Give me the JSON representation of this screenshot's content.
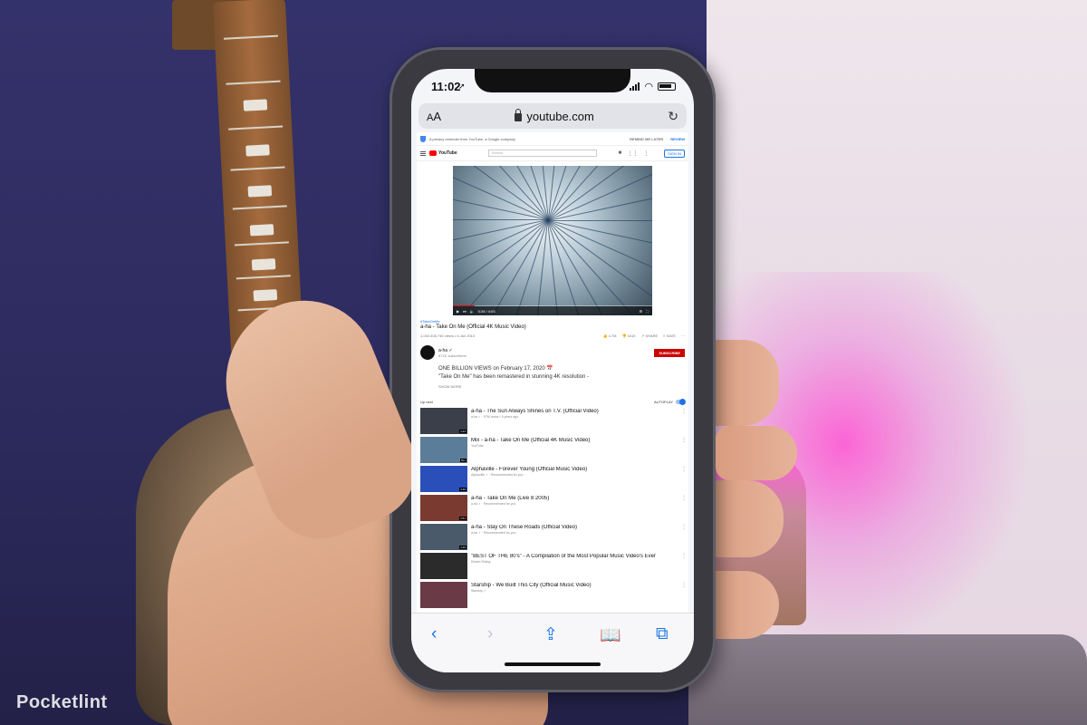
{
  "watermark": "Pocketlint",
  "status_bar": {
    "time": "11:02",
    "location": "➚"
  },
  "address_bar": {
    "aa_small": "A",
    "aa_large": "A",
    "url": "youtube.com"
  },
  "privacy_banner": {
    "text": "A privacy reminder from YouTube, a Google company",
    "remind_later": "REMIND ME LATER",
    "review": "REVIEW"
  },
  "youtube": {
    "logo": "YouTube",
    "search_placeholder": "Search",
    "sign_in": "SIGN IN",
    "player": {
      "time": "0:26 / 4:03",
      "progress": 0.107
    },
    "hashtag": "#TakeOnMe",
    "title": "a-ha - Take On Me (Official 4K Music Video)",
    "views": "1,040,408,746 views • 6 Jan 2010",
    "likes": "4.7M",
    "dislikes": "161K",
    "share": "SHARE",
    "save": "SAVE",
    "channel": {
      "name": "a-ha ✓",
      "subs": "871K subscribers",
      "subscribe": "SUBSCRIBE"
    },
    "description": [
      "ONE BILLION VIEWS on February 17, 2020 📅",
      "\"Take On Me\" has been remastered in stunning 4K resolution -"
    ],
    "show_more": "SHOW MORE",
    "up_next": "Up next",
    "autoplay": "AUTOPLAY",
    "recommendations": [
      {
        "title": "a-ha - The Sun Always Shines on T.V. (Official Video)",
        "sub": "a-ha ✓  ·  57M views • 9 years ago",
        "duration": "4:43",
        "color": "#3b3f4a"
      },
      {
        "title": "Mix - a-ha - Take On Me (Official 4K Music Video)",
        "sub": "YouTube",
        "duration": "50+",
        "color": "#5c7d9a"
      },
      {
        "title": "Alphaville - Forever Young (Official Music Video)",
        "sub": "Alphaville ✓  ·  Recommended for you",
        "duration": "3:46",
        "color": "#2a4fb8"
      },
      {
        "title": "a-ha - Take On Me (Live 8 2005)",
        "sub": "a-ha ✓  ·  Recommended for you",
        "duration": "3:51",
        "color": "#7a3a30"
      },
      {
        "title": "a-ha - Stay On These Roads (Official Video)",
        "sub": "a-ha ✓  ·  Recommended for you",
        "duration": "4:46",
        "color": "#4a5a6a"
      },
      {
        "title": "\"BEST OF THE 80's\" - A Compilation of the Most Popular Music Video's Ever",
        "sub": "Robert Riding",
        "duration": "",
        "color": "#2b2b2b"
      },
      {
        "title": "Starship - We Built This City (Official Music Video)",
        "sub": "Starship ✓",
        "duration": "",
        "color": "#6a3b46"
      }
    ]
  }
}
